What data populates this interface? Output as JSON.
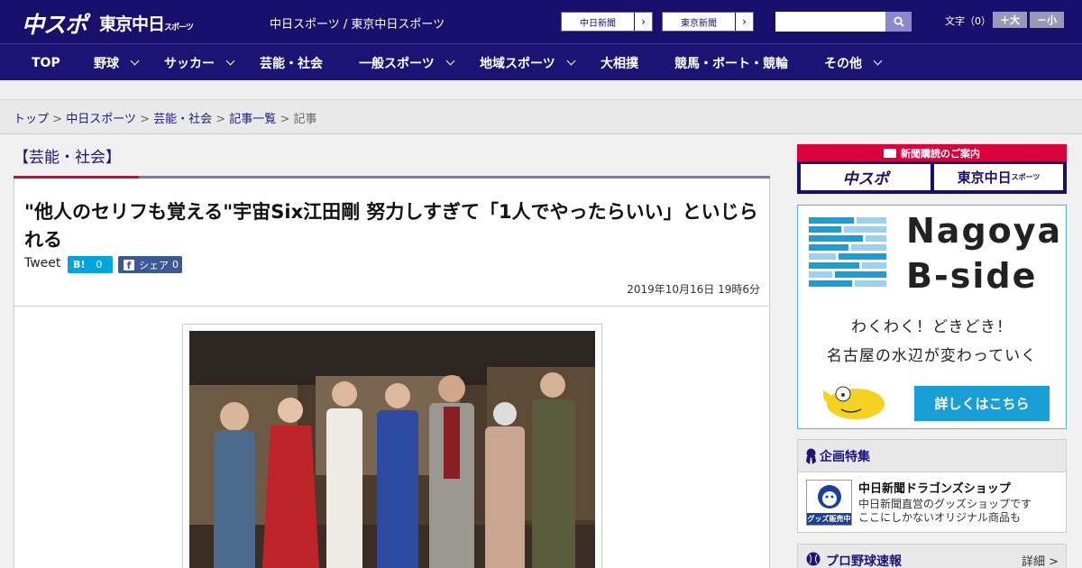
{
  "header": {
    "logo_main": "中スポ",
    "logo_tokyo": "東京中日",
    "logo_tokyo_small": "スポーツ",
    "tagline": "中日スポーツ / 東京中日スポーツ",
    "btn_chunichi": "中日新聞",
    "btn_tokyo": "東京新聞",
    "search_placeholder": "",
    "font_size_label": "文字（0）",
    "font_up": "＋大",
    "font_down": "－小"
  },
  "nav": {
    "items": [
      {
        "label": "TOP",
        "chevron": false
      },
      {
        "label": "野球",
        "chevron": true
      },
      {
        "label": "サッカー",
        "chevron": true
      },
      {
        "label": "芸能・社会",
        "chevron": false
      },
      {
        "label": "一般スポーツ",
        "chevron": true
      },
      {
        "label": "地域スポーツ",
        "chevron": true
      },
      {
        "label": "大相撲",
        "chevron": false
      },
      {
        "label": "競馬・ボート・競輪",
        "chevron": false
      },
      {
        "label": "その他",
        "chevron": true
      }
    ]
  },
  "breadcrumb": {
    "items": [
      "トップ",
      "中日スポーツ",
      "芸能・社会",
      "記事一覧"
    ],
    "current": "記事",
    "separator": " > "
  },
  "article": {
    "section": "【芸能・社会】",
    "headline": "\"他人のセリフも覚える\"宇宙Six江田剛 努力しすぎて「1人でやったらいい」といじられる",
    "tweet": "Tweet",
    "hatena_label": "B!",
    "hatena_count": "0",
    "fb_label": "シェア",
    "fb_count": "0",
    "date": "2019年10月16日 19時6分"
  },
  "sidebar": {
    "subscribe_title": "新聞購読のご案内",
    "subscribe_btn1": "中スポ",
    "subscribe_btn2": "東京中日",
    "subscribe_btn2_small": "スポーツ",
    "ad_title1": "Nagoya",
    "ad_title2": "B-side",
    "ad_line1": "わくわく！どきどき！",
    "ad_line2": "名古屋の水辺が変わっていく",
    "ad_button": "詳しくはこちら",
    "feature_header": "企画特集",
    "feature_title": "中日新聞ドラゴンズショップ",
    "feature_desc1": "中日新聞直営のグッズショップです",
    "feature_desc2": "ここにしかないオリジナル商品も",
    "feature_icon_text": "グッズ販売中",
    "pro_header": "プロ野球速報",
    "pro_detail": "詳細 >"
  },
  "colors": {
    "brand": "#19106e",
    "accent": "#d9003b",
    "ad_blue": "#1a9ed6"
  }
}
